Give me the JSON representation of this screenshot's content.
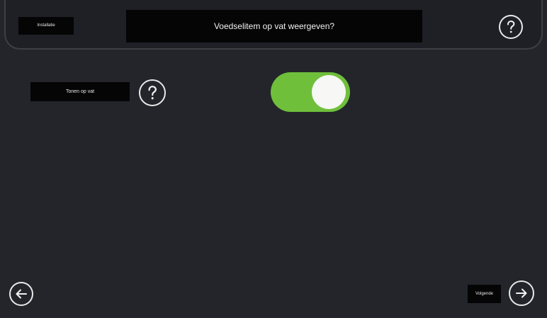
{
  "header": {
    "install_label": "Installatie",
    "title": "Voedselitem op vat weergeven?",
    "help_icon": "question-mark-icon"
  },
  "setting": {
    "label": "Tonen op vat",
    "help_icon": "question-mark-icon",
    "toggle_state": "on",
    "toggle_color": "#6fbf3b"
  },
  "footer": {
    "back_icon": "arrow-left-icon",
    "next_label": "Volgende",
    "next_icon": "arrow-right-icon"
  },
  "colors": {
    "background": "#23252b",
    "header_background": "#1e2026",
    "label_background": "#050506",
    "accent": "#6fbf3b"
  }
}
